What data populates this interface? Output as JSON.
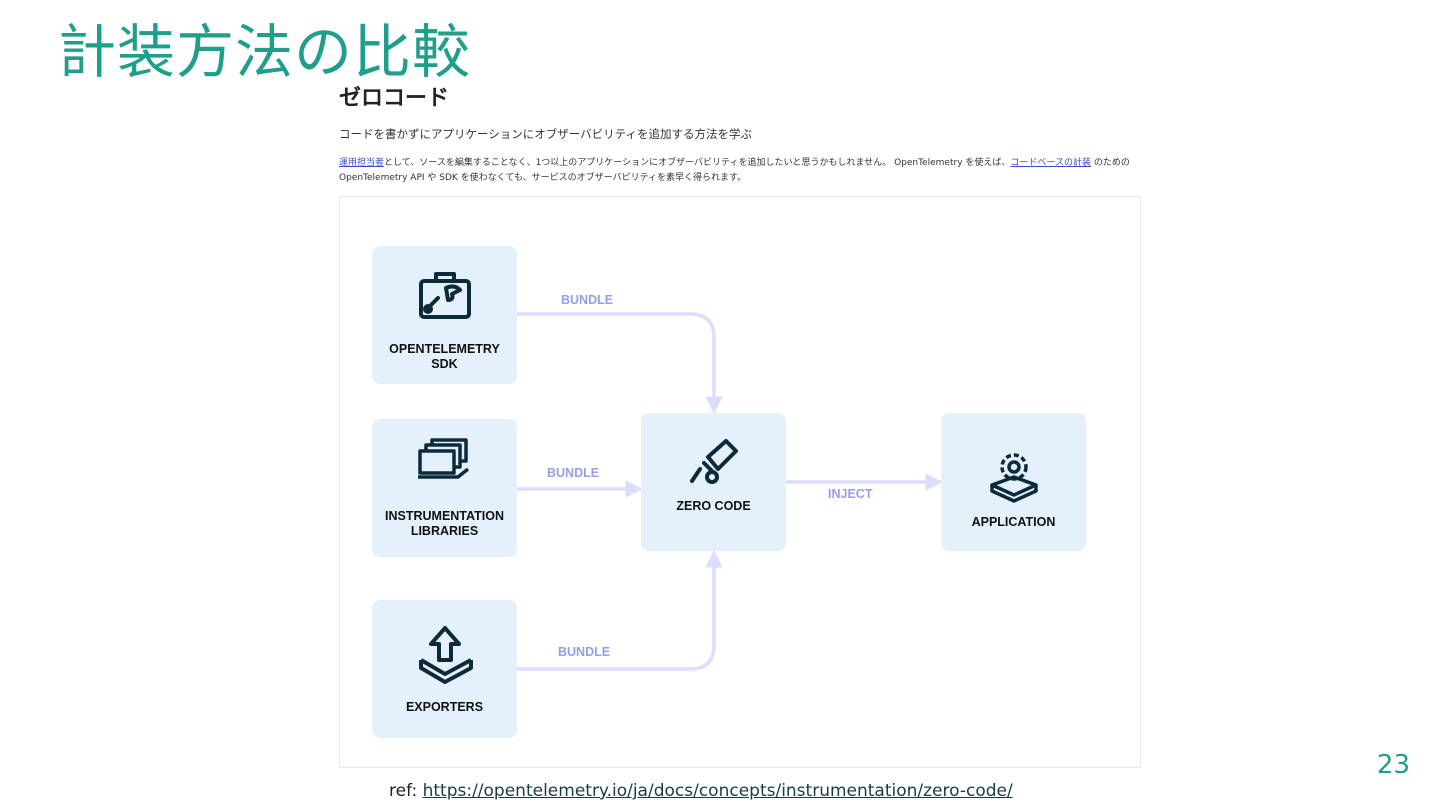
{
  "slide": {
    "title": "計装方法の比較",
    "page_number": "23",
    "ref_label": "ref: ",
    "ref_url": "https://opentelemetry.io/ja/docs/concepts/instrumentation/zero-code/"
  },
  "doc": {
    "heading": "ゼロコード",
    "subtitle": "コードを書かずにアプリケーションにオブザーバビリティを追加する方法を学ぶ",
    "body_link1": "運用担当者",
    "body_text1": "として、ソースを編集することなく、1つ以上のアプリケーションにオブザーバビリティを追加したいと思うかもしれません。 OpenTelemetry を使えば、",
    "body_link2": "コードベースの計装",
    "body_text2": " のための OpenTelemetry API や SDK を使わなくても、サービスのオブザーバビリティを素早く得られます。"
  },
  "diagram": {
    "nodes": {
      "sdk": {
        "label": "OPENTELEMETRY\nSDK",
        "icon": "toolbox-wrench-icon"
      },
      "libraries": {
        "label": "INSTRUMENTATION\nLIBRARIES",
        "icon": "stacked-windows-icon"
      },
      "exporters": {
        "label": "EXPORTERS",
        "icon": "upload-arrow-icon"
      },
      "zero_code": {
        "label": "ZERO CODE",
        "icon": "telescope-icon"
      },
      "application": {
        "label": "APPLICATION",
        "icon": "gear-platform-icon"
      }
    },
    "edges": {
      "sdk_bundle": "BUNDLE",
      "libraries_bundle": "BUNDLE",
      "exporters_bundle": "BUNDLE",
      "inject": "INJECT"
    },
    "colors": {
      "box": "#e4f0fa",
      "edge": "#dcdcfb",
      "edge_label": "#9a9ce8",
      "icon": "#0d2a3a"
    }
  }
}
